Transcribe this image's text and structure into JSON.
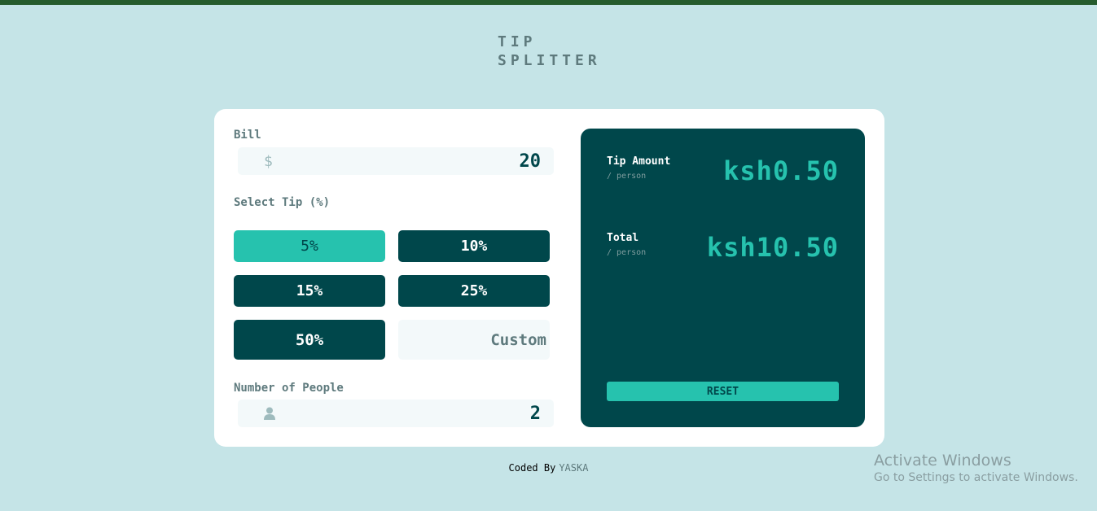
{
  "logo": {
    "line1": "TIP",
    "line2": "SPLITTER"
  },
  "bill": {
    "label": "Bill",
    "icon": "dollar-icon",
    "icon_glyph": "$",
    "value": "20"
  },
  "tip": {
    "label": "Select Tip (%)",
    "options": [
      "5%",
      "10%",
      "15%",
      "25%",
      "50%"
    ],
    "selected": "5%",
    "custom_placeholder": "Custom"
  },
  "people": {
    "label": "Number of People",
    "icon": "person-icon",
    "value": "2"
  },
  "results": {
    "tip_amount_label": "Tip Amount",
    "tip_amount_sub": "/ person",
    "tip_amount_value": "ksh0.50",
    "total_label": "Total",
    "total_sub": "/ person",
    "total_value": "ksh10.50",
    "reset_label": "RESET"
  },
  "footer": {
    "prefix": "Coded By",
    "author": "YASKA"
  },
  "watermark": {
    "line1": "Activate Windows",
    "line2": "Go to Settings to activate Windows."
  },
  "colors": {
    "background": "#c5e4e7",
    "dark_teal": "#00474b",
    "accent": "#26c2ae",
    "topbar": "#265c2d"
  }
}
